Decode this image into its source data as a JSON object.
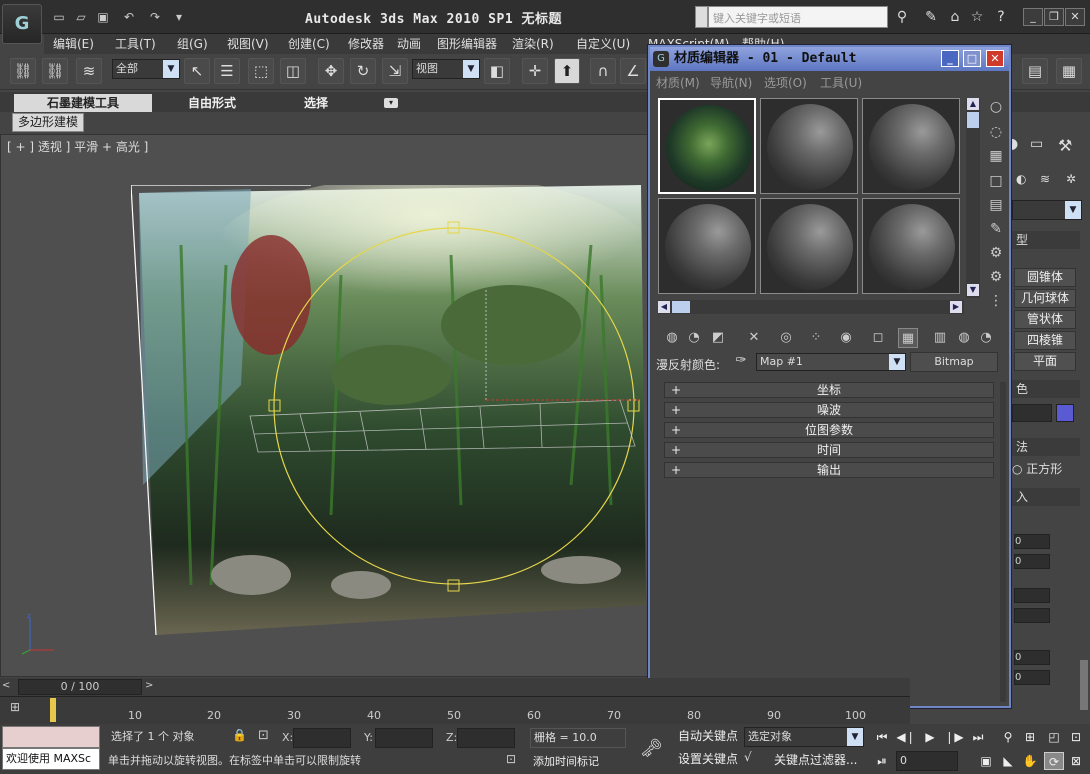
{
  "app": {
    "title": "Autodesk 3ds Max  2010 SP1",
    "doc": "无标题",
    "logo": "G"
  },
  "search": {
    "placeholder": "键入关键字或短语"
  },
  "menu": [
    "编辑(E)",
    "工具(T)",
    "组(G)",
    "视图(V)",
    "创建(C)",
    "修改器",
    "动画",
    "图形编辑器",
    "渲染(R)",
    "自定义(U)",
    "MAXScript(M)",
    "帮助(H)"
  ],
  "toolbar": {
    "selection_filter": "全部",
    "ref_coord": "视图"
  },
  "ribbon": {
    "tabs": [
      "石墨建模工具",
      "自由形式",
      "选择"
    ],
    "sub": "多边形建模"
  },
  "viewport": {
    "label": "[ + ] 透视 ] 平滑 + 高光 ]"
  },
  "material_editor": {
    "title": "材质编辑器 - 01 - Default",
    "menu": [
      "材质(M)",
      "导航(N)",
      "选项(O)",
      "工具(U)"
    ],
    "diffuse_label": "漫反射颜色:",
    "map_name": "Map #1",
    "map_type": "Bitmap",
    "rollouts": [
      "坐标",
      "噪波",
      "位图参数",
      "时间",
      "输出"
    ]
  },
  "command_panel": {
    "buttons": [
      "圆锥体",
      "几何球体",
      "管状体",
      "四棱锥",
      "平面"
    ],
    "labels": [
      "型",
      "色",
      "法",
      "入"
    ],
    "radio": "正方形",
    "colors": {
      "swatch": "#5a5ad2"
    }
  },
  "timeline": {
    "slider": "0 / 100",
    "ticks": [
      "10",
      "20",
      "30",
      "40",
      "50",
      "60",
      "70",
      "80",
      "90",
      "100"
    ]
  },
  "status": {
    "welcome": "欢迎使用 MAXSc",
    "selected": "选择了 1 个 对象",
    "hint": "单击并拖动以旋转视图。在标签中单击可以限制旋转",
    "x": "X:",
    "y": "Y:",
    "z": "Z:",
    "grid": "栅格 = 10.0",
    "add_time_tag": "添加时间标记",
    "auto_key": "自动关键点",
    "set_key": "设置关键点",
    "key_mode": "选定对象",
    "key_filters": "关键点过滤器...",
    "frame": "0"
  }
}
